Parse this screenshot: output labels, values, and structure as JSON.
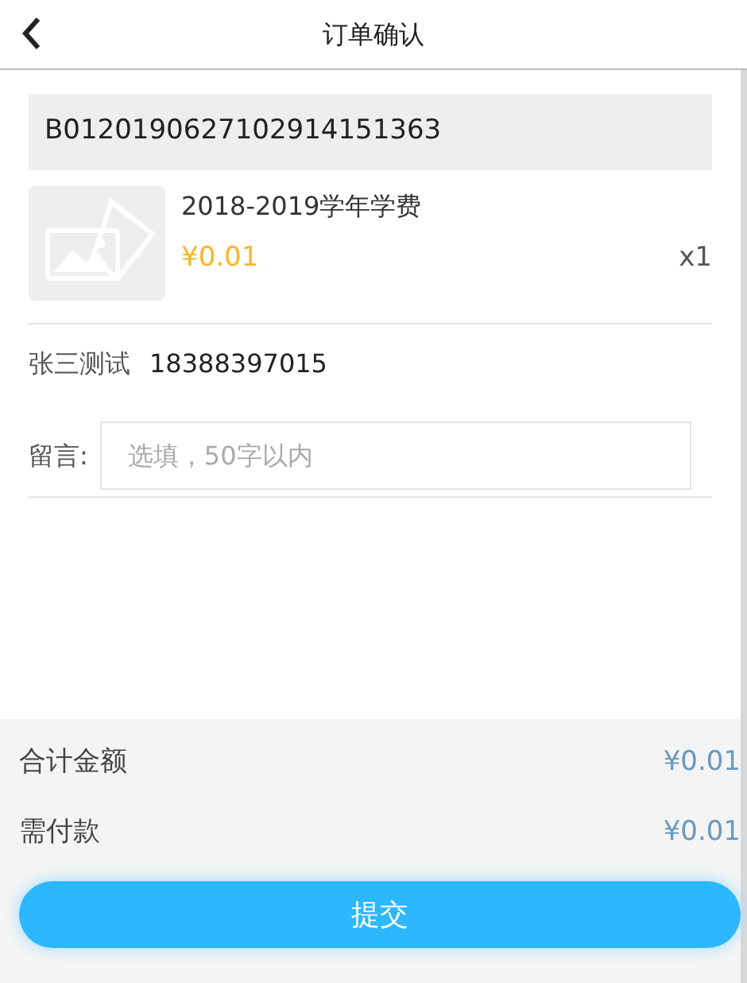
{
  "header": {
    "title": "订单确认"
  },
  "order": {
    "number": "B0120190627102914151363"
  },
  "product": {
    "name": "2018-2019学年学费",
    "price": "¥0.01",
    "quantity": "x1"
  },
  "contact": {
    "name": "张三测试",
    "phone": "18388397015"
  },
  "message": {
    "label": "留言:",
    "placeholder": "选填，50字以内"
  },
  "totals": [
    {
      "label": "合计金额",
      "value": "¥0.01"
    },
    {
      "label": "需付款",
      "value": "¥0.01"
    }
  ],
  "submit": "提交"
}
